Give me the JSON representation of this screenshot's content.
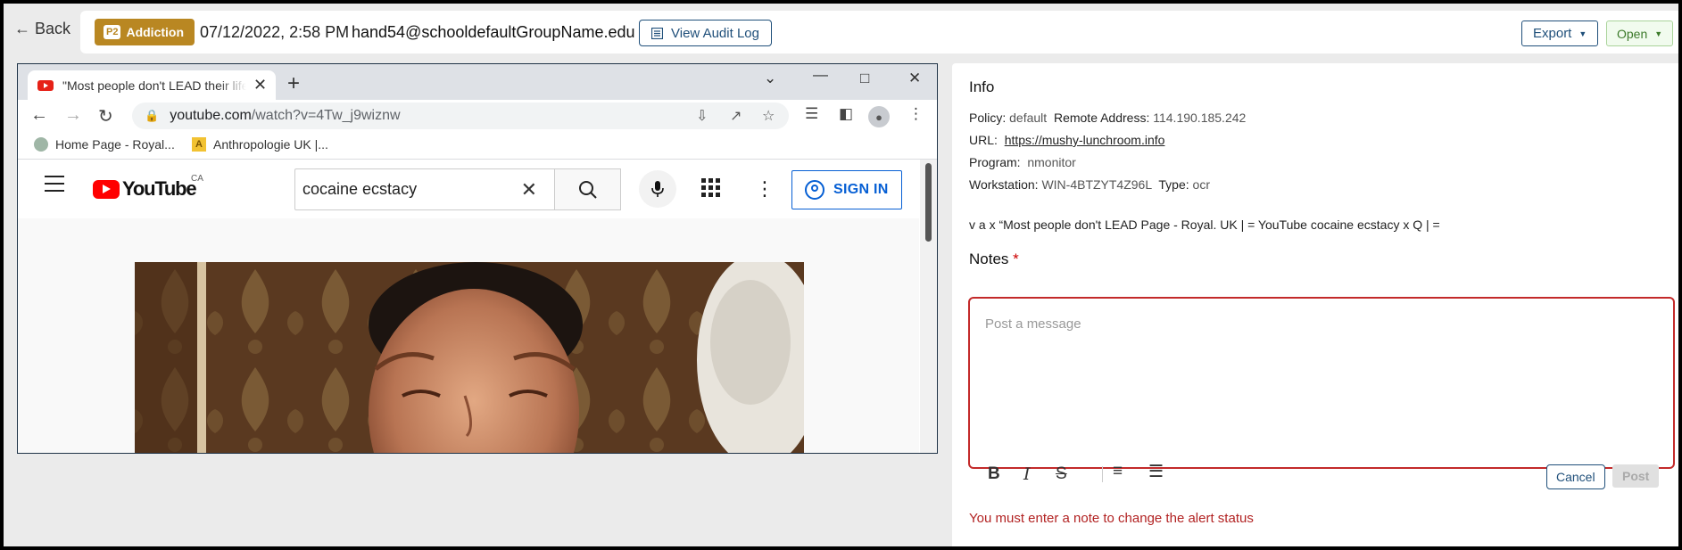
{
  "topbar": {
    "back_label": "Back",
    "badge_icon": "P2",
    "badge_label": "Addiction",
    "datetime": "07/12/2022, 2:58 PM",
    "email": "hand54@schooldefaultGroupName.edu",
    "audit_label": "View Audit Log",
    "export_label": "Export",
    "open_label": "Open"
  },
  "browser": {
    "tab_title": "\"Most people don't LEAD their life",
    "url_host": "youtube.com",
    "url_path": "/watch?v=4Tw_j9wiznw",
    "bookmarks": [
      "Home Page - Royal...",
      "Anthropologie UK |..."
    ],
    "yt": {
      "logo_text": "YouTube",
      "region": "CA",
      "search_value": "cocaine ecstacy",
      "signin_label": "SIGN IN"
    }
  },
  "info": {
    "title": "Info",
    "policy_label": "Policy:",
    "policy_value": "default",
    "remote_label": "Remote Address:",
    "remote_value": "114.190.185.242",
    "url_label": "URL:",
    "url_value": "https://mushy-lunchroom.info",
    "program_label": "Program:",
    "program_value": "nmonitor",
    "workstation_label": "Workstation:",
    "workstation_value": "WIN-4BTZYT4Z96L",
    "type_label": "Type:",
    "type_value": "ocr",
    "ocr_text": "v a x “Most people don't LEAD Page - Royal. UK | = YouTube cocaine ecstacy x Q | ="
  },
  "notes": {
    "title": "Notes",
    "required_mark": "*",
    "placeholder": "Post a message",
    "cancel_label": "Cancel",
    "post_label": "Post",
    "error": "You must enter a note to change the alert status"
  },
  "colors": {
    "badge": "#b98722",
    "accent": "#1f4f7a",
    "error": "#b22222",
    "open": "#3c7a2a"
  }
}
